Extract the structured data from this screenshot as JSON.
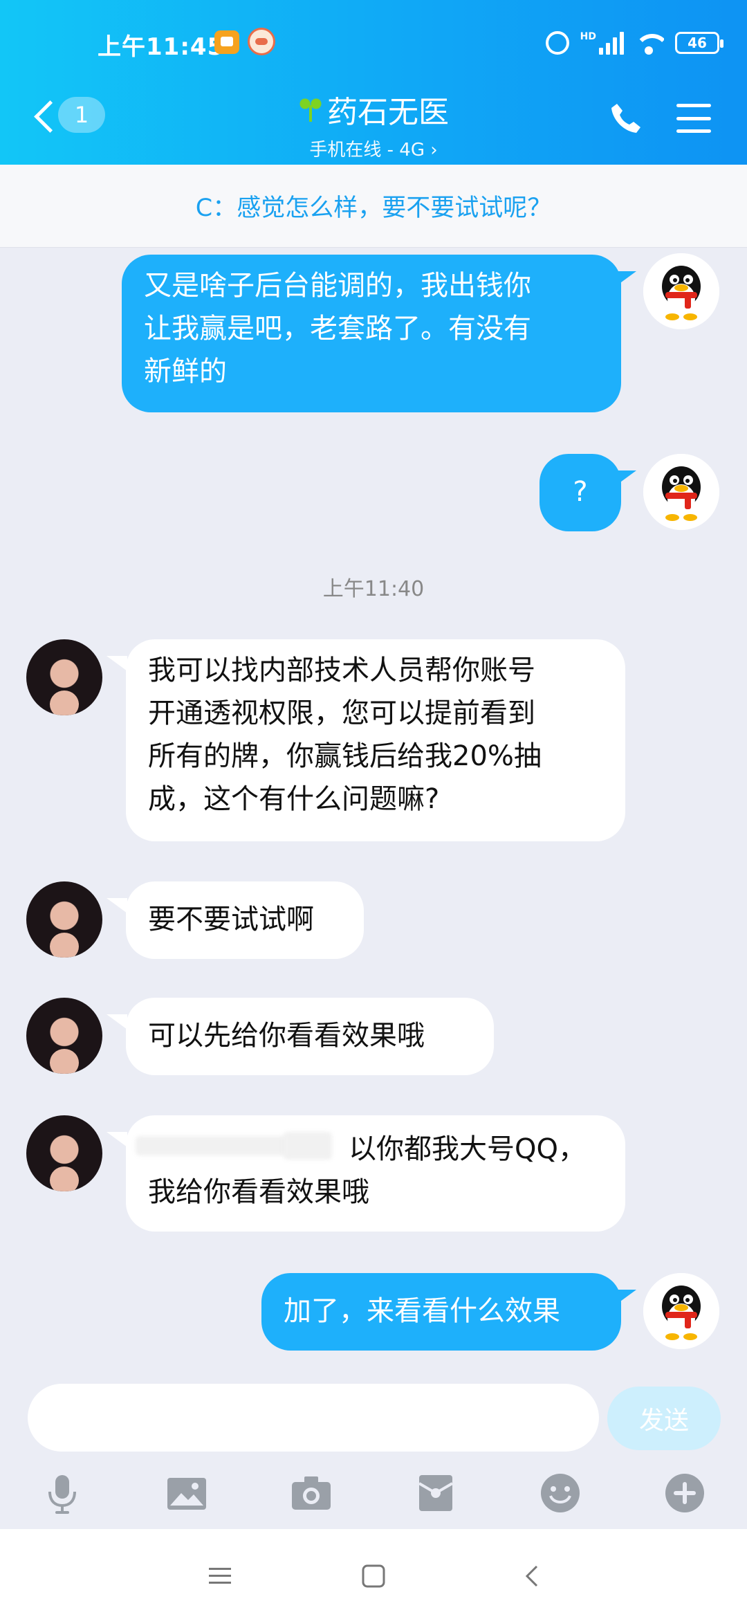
{
  "status_bar": {
    "time": "上午11:45",
    "network_tag": "HD",
    "battery_level": "46"
  },
  "header": {
    "back_count": "1",
    "contact_name": "药石无医",
    "subtitle": "手机在线 - 4G ›"
  },
  "pinned_message": "C：感觉怎么样，要不要试试呢？",
  "messages": [
    {
      "side": "out",
      "lines": [
        "又是啥子后台能调的，我出钱你",
        "让我赢是吧，老套路了。有没有",
        "新鲜的"
      ]
    },
    {
      "side": "out",
      "lines": [
        "?"
      ]
    },
    {
      "side": "in",
      "lines": [
        "我可以找内部技术人员帮你账号",
        "开通透视权限，您可以提前看到",
        "所有的牌，你赢钱后给我20%抽",
        "成，这个有什么问题嘛?"
      ]
    },
    {
      "side": "in",
      "lines": [
        "要不要试试啊"
      ]
    },
    {
      "side": "in",
      "lines": [
        "可以先给你看看效果哦"
      ]
    },
    {
      "side": "in",
      "lines": [
        "以你都我大号QQ，",
        "我给你看看效果哦"
      ]
    },
    {
      "side": "out",
      "lines": [
        "加了，来看看什么效果"
      ]
    }
  ],
  "timestamp": "上午11:40",
  "composer": {
    "placeholder": "",
    "send_label": "发送"
  },
  "toolbar_icons": [
    "microphone-icon",
    "image-icon",
    "camera-icon",
    "red-packet-icon",
    "emoji-icon",
    "plus-icon"
  ],
  "colors": {
    "header_start": "#12c6f7",
    "header_end": "#0e93f3",
    "outgoing_bubble": "#1eb0fb",
    "pinned_text": "#1aa1f0",
    "chat_background": "#ebedf5"
  }
}
